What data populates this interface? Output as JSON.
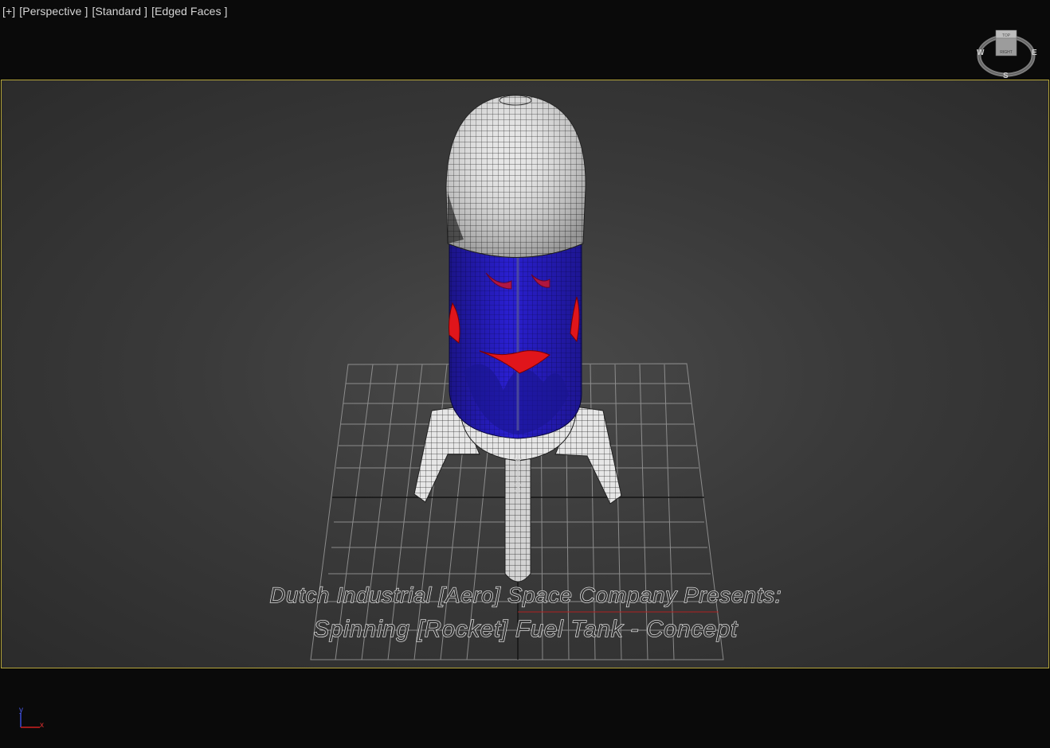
{
  "viewport": {
    "labels": [
      "[+]",
      "[Perspective ]",
      "[Standard ]",
      "[Edged Faces ]"
    ]
  },
  "viewcube": {
    "top_label": "TOP",
    "front_label": "RIGHT",
    "west": "W",
    "east": "E",
    "south": "S"
  },
  "caption": {
    "line1": "Dutch Industrial [Aero] Space Company Presents:",
    "line2": "Spinning [Rocket] Fuel Tank - Concept"
  },
  "axis_tripod": {
    "y_label": "y",
    "x_label": "x"
  },
  "colors": {
    "safe_frame_border": "#b5a53a",
    "mesh_white": "#e8e8e8",
    "tank_blue": "#2a1fd0",
    "accent_red": "#e0151b",
    "grid": "#9a9a9a"
  },
  "icons": {
    "viewcube": "viewcube-icon",
    "axis": "axis-tripod-icon"
  }
}
